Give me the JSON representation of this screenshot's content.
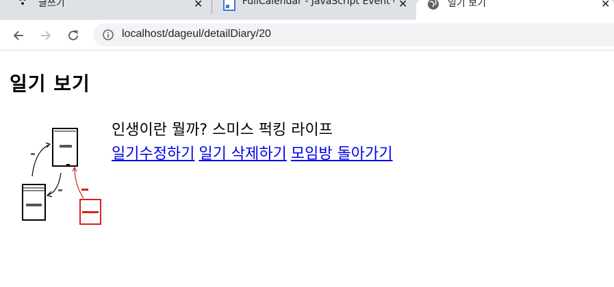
{
  "browser": {
    "tabs": [
      {
        "label": "글쓰기",
        "active": false
      },
      {
        "label": "FullCalendar - JavaScript Event C",
        "active": false
      },
      {
        "label": "일기 보기",
        "active": true
      }
    ],
    "url": "localhost/dageul/detailDiary/20"
  },
  "page": {
    "heading": "일기 보기",
    "diary_title": "인생이란 뭘까? 스미스 퍽킹 라이프",
    "links": [
      "일기수정하기",
      "일기 삭제하기",
      "모임방 돌아가기"
    ]
  },
  "colors": {
    "link": "#0000ee",
    "tabstrip": "#dee1e6",
    "omnibox": "#f1f3f4",
    "diagram_red": "#d42020"
  }
}
